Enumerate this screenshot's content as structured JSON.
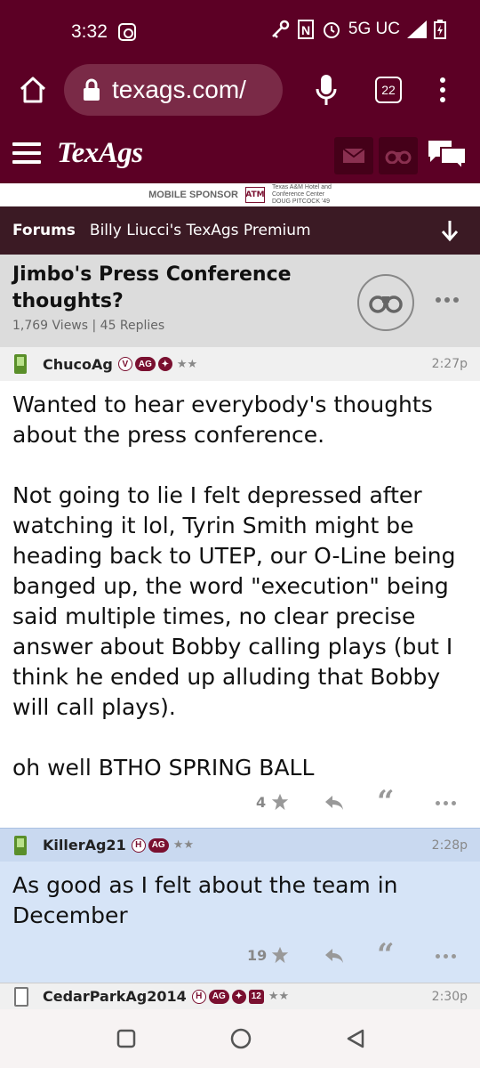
{
  "status": {
    "time": "3:32",
    "network": "5G UC"
  },
  "browser": {
    "url": "texags.com/",
    "tab_count": "22"
  },
  "site": {
    "logo": "TexAgs",
    "sponsor_label": "MOBILE SPONSOR",
    "sponsor_mark": "ATM",
    "sponsor_text_1": "Texas A&M Hotel and",
    "sponsor_text_2": "Conference Center",
    "sponsor_text_3": "DOUG PITCOCK '49"
  },
  "forum": {
    "forums_label": "Forums",
    "board": "Billy Liucci's TexAgs Premium"
  },
  "thread": {
    "title": "Jimbo's Press Conference thoughts?",
    "meta": "1,769 Views | 45 Replies"
  },
  "posts": [
    {
      "user": "ChucoAg",
      "badges": [
        "V",
        "AG"
      ],
      "stars": "★★",
      "time": "2:27p",
      "body": "Wanted to hear everybody's thoughts about the press conference.\n\nNot going to lie I felt depressed after watching it lol, Tyrin Smith might be heading back to UTEP, our O-Line being banged up, the word \"execution\" being said multiple times, no clear precise answer about Bobby calling plays (but I think he ended up alluding that Bobby will call plays).\n\noh well BTHO SPRING BALL",
      "star_count": "4"
    },
    {
      "user": "KillerAg21",
      "badges": [
        "H",
        "AG"
      ],
      "stars": "★★",
      "time": "2:28p",
      "body": "As good as I felt about the team in December",
      "star_count": "19"
    },
    {
      "user": "CedarParkAg2014",
      "badges": [
        "H",
        "AG",
        "12"
      ],
      "stars": "★★",
      "time": "2:30p"
    }
  ],
  "colors": {
    "maroon": "#5c0025",
    "highlight_row": "#d6e4f7"
  }
}
